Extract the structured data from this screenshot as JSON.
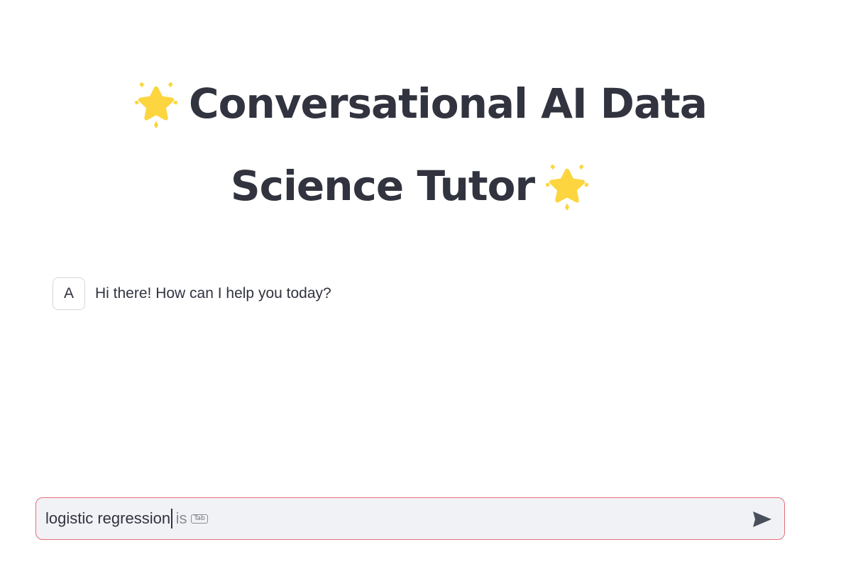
{
  "title": {
    "line1": "Conversational AI Data",
    "line2": "Science Tutor",
    "emoji_icon": "glowing-star-icon",
    "emoji_color": "#fcd53f"
  },
  "chat": {
    "messages": [
      {
        "role": "assistant",
        "avatar_label": "A",
        "text": "Hi there! How can I help you today?"
      }
    ]
  },
  "input": {
    "value": "logistic regression",
    "suggestion": "is",
    "suggestion_key": "Tab",
    "border_color": "#e8707a",
    "send_icon": "send-arrow-icon"
  }
}
